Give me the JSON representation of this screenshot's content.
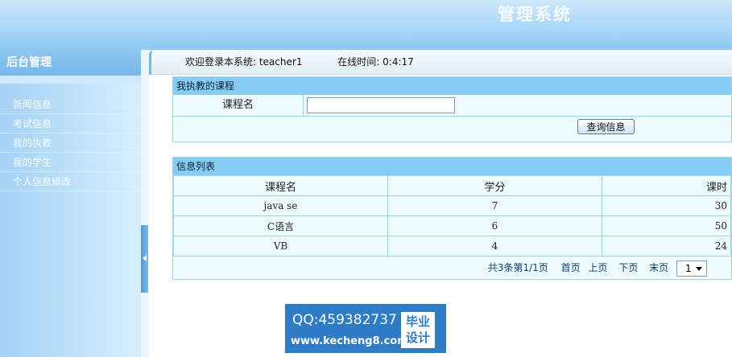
{
  "header": {
    "title": "管理系统"
  },
  "sidebar": {
    "title": "后台管理",
    "items": [
      {
        "label": "新闻信息"
      },
      {
        "label": "考试信息"
      },
      {
        "label": "我的执教"
      },
      {
        "label": "我的学生"
      },
      {
        "label": "个人信息修改"
      }
    ]
  },
  "infobar": {
    "welcome": "欢迎登录本系统: teacher1",
    "online_time": "在线时间: 0:4:17"
  },
  "search": {
    "title": "我执教的课程",
    "course_label": "课程名",
    "course_value": "",
    "button": "查询信息"
  },
  "list": {
    "title": "信息列表",
    "columns": [
      "课程名",
      "学分",
      "课时"
    ],
    "rows": [
      [
        "java se",
        "7",
        "30"
      ],
      [
        "C语言",
        "6",
        "50"
      ],
      [
        "VB",
        "4",
        "24"
      ]
    ]
  },
  "pager": {
    "total": "共3条",
    "page_info": "第1/1页",
    "first": "首页",
    "prev": "上页",
    "next": "下页",
    "last": "末页",
    "selected_page": "1"
  },
  "watermark": {
    "qq": "QQ:459382737",
    "site": "www.kecheng8.com",
    "seal_line1": "毕业",
    "seal_line2": "设计"
  }
}
